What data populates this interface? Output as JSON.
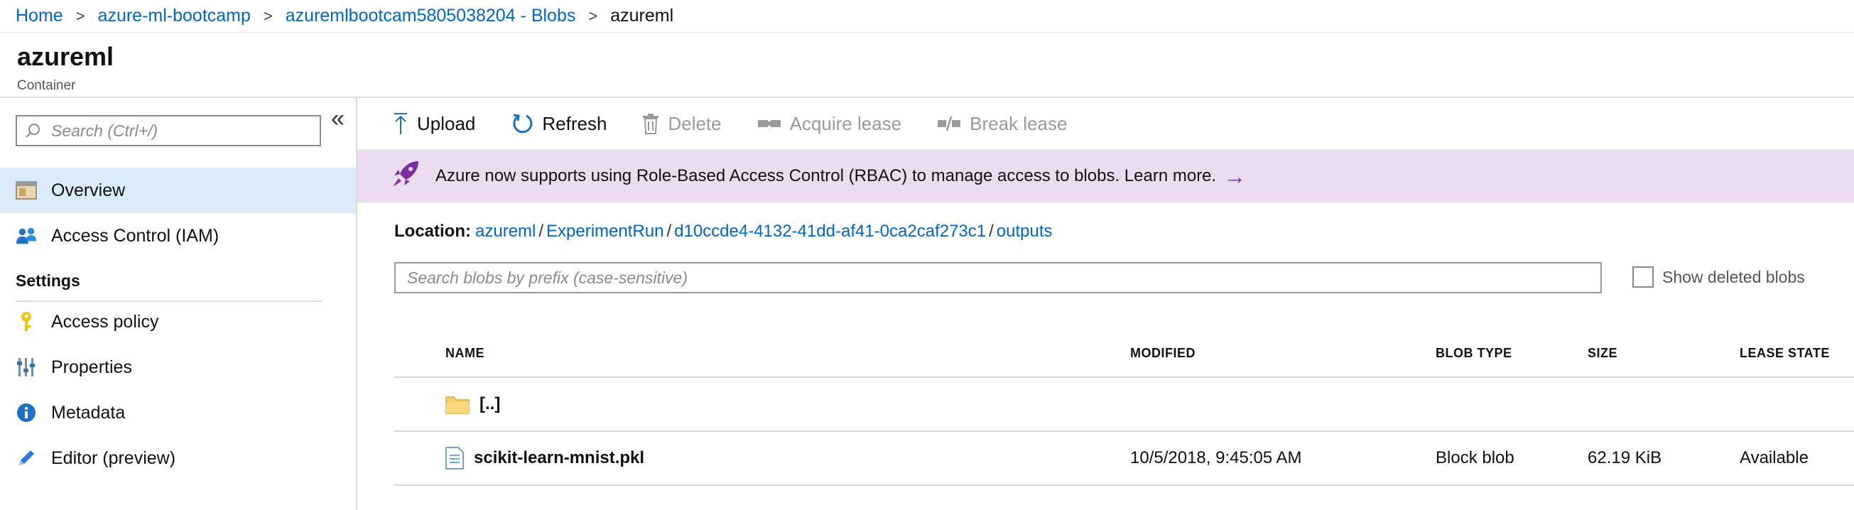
{
  "breadcrumb": {
    "items": [
      "Home",
      "azure-ml-bootcamp",
      "azuremlbootcam5805038204 - Blobs"
    ],
    "current": "azureml"
  },
  "header": {
    "title": "azureml",
    "subtitle": "Container"
  },
  "sidebar": {
    "search_placeholder": "Search (Ctrl+/)",
    "collapse_glyph": "«",
    "items": [
      {
        "label": "Overview",
        "icon": "overview-icon",
        "active": true
      },
      {
        "label": "Access Control (IAM)",
        "icon": "people-icon",
        "active": false
      }
    ],
    "section_title": "Settings",
    "settings_items": [
      {
        "label": "Access policy",
        "icon": "key-icon"
      },
      {
        "label": "Properties",
        "icon": "sliders-icon"
      },
      {
        "label": "Metadata",
        "icon": "info-icon"
      },
      {
        "label": "Editor (preview)",
        "icon": "pencil-icon"
      }
    ]
  },
  "toolbar": {
    "upload": "Upload",
    "refresh": "Refresh",
    "delete": "Delete",
    "acquire_lease": "Acquire lease",
    "break_lease": "Break lease"
  },
  "banner": {
    "text": "Azure now supports using Role-Based Access Control (RBAC) to manage access to blobs. Learn more.",
    "arrow": "→"
  },
  "location": {
    "label": "Location:",
    "parts": [
      "azureml",
      "ExperimentRun",
      "d10ccde4-4132-41dd-af41-0ca2caf273c1",
      "outputs"
    ],
    "separator": "/"
  },
  "filter": {
    "placeholder": "Search blobs by prefix (case-sensitive)",
    "show_deleted_label": "Show deleted blobs"
  },
  "table": {
    "columns": [
      "NAME",
      "MODIFIED",
      "BLOB TYPE",
      "SIZE",
      "LEASE STATE"
    ],
    "rows": [
      {
        "name": "[..]",
        "icon": "folder-icon",
        "modified": "",
        "blob_type": "",
        "size": "",
        "lease_state": ""
      },
      {
        "name": "scikit-learn-mnist.pkl",
        "icon": "file-icon",
        "modified": "10/5/2018, 9:45:05 AM",
        "blob_type": "Block blob",
        "size": "62.19 KiB",
        "lease_state": "Available"
      }
    ]
  },
  "colors": {
    "link": "#0066c8",
    "active_nav": "#dcebf9",
    "banner_bg": "#ebdcef",
    "banner_accent": "#7a2fa0"
  }
}
